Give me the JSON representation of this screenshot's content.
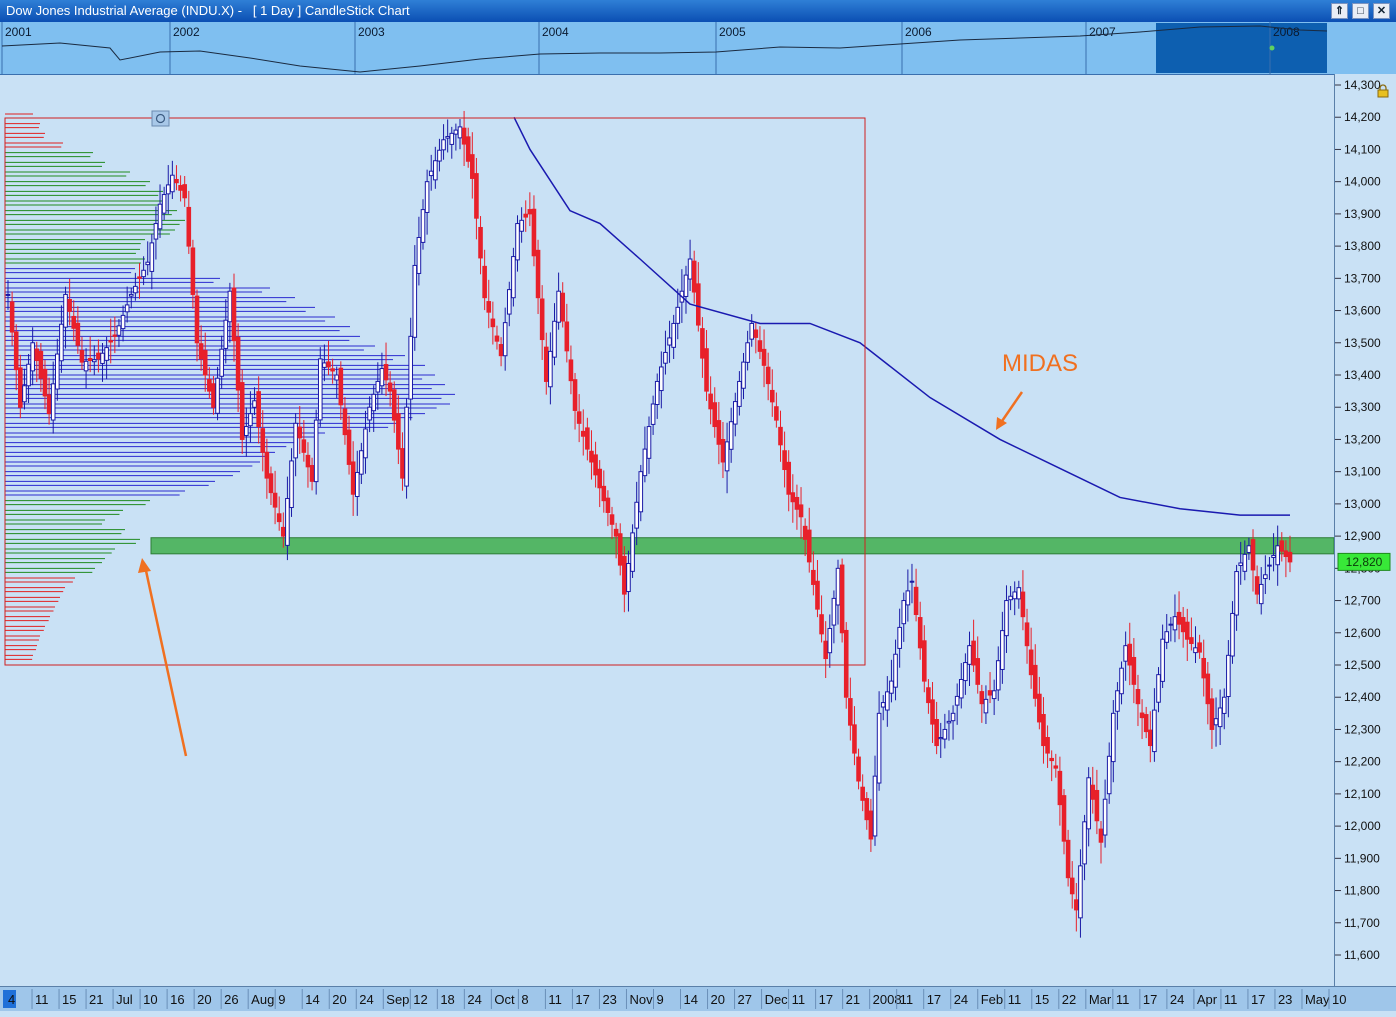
{
  "window": {
    "title": "Dow Jones Industrial Average (INDU.X) -   [ 1 Day ] CandleStick Chart",
    "buttons": [
      "⇑",
      "□",
      "✕"
    ]
  },
  "overview": {
    "years": [
      "2001",
      "2002",
      "2003",
      "2004",
      "2005",
      "2006",
      "2007",
      "2008"
    ]
  },
  "annotations": {
    "midas_label": "MIDAS"
  },
  "colors": {
    "up": "#1a1aa6",
    "down": "#e8202a",
    "midas_line": "#1a1ab0",
    "profile_blue": "#2a2ad0",
    "profile_green": "#1e8a1e",
    "profile_red": "#e02020",
    "zone_fill": "#3fae4c",
    "arrow": "#f07020",
    "box": "#d02020",
    "last_price_bg": "#38e838"
  },
  "chart_data": {
    "type": "candlestick",
    "ylim": [
      11580,
      14330
    ],
    "y_ticks": [
      14300,
      14200,
      14100,
      14000,
      13900,
      13800,
      13700,
      13600,
      13500,
      13400,
      13300,
      13200,
      13100,
      13000,
      12900,
      12800,
      12700,
      12600,
      12500,
      12400,
      12300,
      12200,
      12100,
      12000,
      11900,
      11800,
      11700,
      11600
    ],
    "y_tick_labels": [
      "14,300",
      "14,200",
      "14,100",
      "14,000",
      "13,900",
      "13,800",
      "13,700",
      "13,600",
      "13,500",
      "13,400",
      "13,300",
      "13,200",
      "13,100",
      "13,000",
      "12,900",
      "12,800",
      "12,700",
      "12,600",
      "12,500",
      "12,400",
      "12,300",
      "12,200",
      "12,100",
      "12,000",
      "11,900",
      "11,800",
      "11,700",
      "11,600"
    ],
    "last_price": 12820,
    "last_price_label": "12,820",
    "support_zone": [
      12845,
      12895
    ],
    "x_labels": [
      "4",
      "11",
      "15",
      "21",
      "Jul",
      "10",
      "16",
      "20",
      "26",
      "Aug",
      "9",
      "14",
      "20",
      "24",
      "Sep",
      "12",
      "18",
      "24",
      "Oct",
      "8",
      "11",
      "17",
      "23",
      "Nov",
      "9",
      "14",
      "20",
      "27",
      "Dec",
      "11",
      "17",
      "21",
      "2008",
      "11",
      "17",
      "24",
      "Feb",
      "11",
      "15",
      "22",
      "Mar",
      "11",
      "17",
      "24",
      "Apr",
      "11",
      "17",
      "23",
      "May",
      "10"
    ],
    "anchors": [
      [
        0,
        13650
      ],
      [
        3,
        13300
      ],
      [
        6,
        13500
      ],
      [
        10,
        13280
      ],
      [
        14,
        13650
      ],
      [
        18,
        13440
      ],
      [
        22,
        13450
      ],
      [
        26,
        13520
      ],
      [
        30,
        13650
      ],
      [
        34,
        13750
      ],
      [
        37,
        13930
      ],
      [
        40,
        14020
      ],
      [
        43,
        13950
      ],
      [
        46,
        13500
      ],
      [
        50,
        13300
      ],
      [
        54,
        13660
      ],
      [
        57,
        13200
      ],
      [
        60,
        13320
      ],
      [
        63,
        13080
      ],
      [
        67,
        12900
      ],
      [
        70,
        13250
      ],
      [
        74,
        13070
      ],
      [
        76,
        13450
      ],
      [
        80,
        13400
      ],
      [
        84,
        13030
      ],
      [
        88,
        13300
      ],
      [
        91,
        13420
      ],
      [
        93,
        13350
      ],
      [
        96,
        13080
      ],
      [
        99,
        13740
      ],
      [
        102,
        14000
      ],
      [
        106,
        14130
      ],
      [
        110,
        14170
      ],
      [
        113,
        14010
      ],
      [
        116,
        13640
      ],
      [
        120,
        13460
      ],
      [
        124,
        13870
      ],
      [
        127,
        13900
      ],
      [
        131,
        13380
      ],
      [
        134,
        13660
      ],
      [
        138,
        13290
      ],
      [
        141,
        13170
      ],
      [
        145,
        13010
      ],
      [
        148,
        12900
      ],
      [
        150,
        12720
      ],
      [
        154,
        13100
      ],
      [
        158,
        13380
      ],
      [
        162,
        13560
      ],
      [
        166,
        13760
      ],
      [
        170,
        13350
      ],
      [
        174,
        13130
      ],
      [
        178,
        13380
      ],
      [
        181,
        13560
      ],
      [
        184,
        13430
      ],
      [
        187,
        13260
      ],
      [
        190,
        13030
      ],
      [
        193,
        12960
      ],
      [
        196,
        12750
      ],
      [
        199,
        12520
      ],
      [
        202,
        12800
      ],
      [
        204,
        12400
      ],
      [
        207,
        12140
      ],
      [
        210,
        11960
      ],
      [
        212,
        12350
      ],
      [
        215,
        12450
      ],
      [
        218,
        12700
      ],
      [
        220,
        12760
      ],
      [
        223,
        12450
      ],
      [
        226,
        12250
      ],
      [
        230,
        12350
      ],
      [
        234,
        12560
      ],
      [
        237,
        12380
      ],
      [
        240,
        12420
      ],
      [
        243,
        12700
      ],
      [
        246,
        12740
      ],
      [
        249,
        12470
      ],
      [
        252,
        12250
      ],
      [
        255,
        12180
      ],
      [
        258,
        11840
      ],
      [
        260,
        11740
      ],
      [
        263,
        12150
      ],
      [
        266,
        11950
      ],
      [
        269,
        12350
      ],
      [
        272,
        12560
      ],
      [
        275,
        12380
      ],
      [
        278,
        12250
      ],
      [
        281,
        12580
      ],
      [
        284,
        12650
      ],
      [
        287,
        12580
      ],
      [
        290,
        12540
      ],
      [
        293,
        12300
      ],
      [
        296,
        12400
      ],
      [
        299,
        12790
      ],
      [
        302,
        12870
      ],
      [
        304,
        12720
      ],
      [
        307,
        12810
      ],
      [
        309,
        12870
      ],
      [
        312,
        12820
      ]
    ],
    "midas_series": [
      [
        514,
        14200
      ],
      [
        530,
        14100
      ],
      [
        570,
        13910
      ],
      [
        600,
        13870
      ],
      [
        640,
        13760
      ],
      [
        690,
        13620
      ],
      [
        760,
        13560
      ],
      [
        810,
        13560
      ],
      [
        860,
        13500
      ],
      [
        930,
        13330
      ],
      [
        1000,
        13200
      ],
      [
        1060,
        13110
      ],
      [
        1120,
        13020
      ],
      [
        1180,
        12985
      ],
      [
        1240,
        12965
      ],
      [
        1290,
        12965
      ]
    ],
    "profile": [
      [
        14210,
        28,
        "red"
      ],
      [
        14180,
        35,
        "red"
      ],
      [
        14150,
        40,
        "red"
      ],
      [
        14120,
        58,
        "red"
      ],
      [
        14090,
        88,
        "green"
      ],
      [
        14060,
        100,
        "green"
      ],
      [
        14030,
        125,
        "green"
      ],
      [
        14000,
        145,
        "green"
      ],
      [
        13970,
        158,
        "green"
      ],
      [
        13940,
        160,
        "green"
      ],
      [
        13910,
        172,
        "green"
      ],
      [
        13880,
        180,
        "green"
      ],
      [
        13850,
        170,
        "green"
      ],
      [
        13820,
        140,
        "green"
      ],
      [
        13790,
        135,
        "green"
      ],
      [
        13760,
        140,
        "green"
      ],
      [
        13730,
        130,
        "blue"
      ],
      [
        13700,
        215,
        "blue"
      ],
      [
        13670,
        265,
        "blue"
      ],
      [
        13640,
        290,
        "blue"
      ],
      [
        13610,
        310,
        "blue"
      ],
      [
        13580,
        330,
        "blue"
      ],
      [
        13550,
        345,
        "blue"
      ],
      [
        13520,
        355,
        "blue"
      ],
      [
        13490,
        370,
        "blue"
      ],
      [
        13460,
        400,
        "blue"
      ],
      [
        13430,
        420,
        "blue"
      ],
      [
        13400,
        430,
        "blue"
      ],
      [
        13370,
        440,
        "blue"
      ],
      [
        13340,
        450,
        "blue"
      ],
      [
        13310,
        445,
        "blue"
      ],
      [
        13280,
        420,
        "blue"
      ],
      [
        13250,
        395,
        "blue"
      ],
      [
        13220,
        320,
        "blue"
      ],
      [
        13190,
        290,
        "blue"
      ],
      [
        13160,
        270,
        "blue"
      ],
      [
        13130,
        255,
        "blue"
      ],
      [
        13100,
        235,
        "blue"
      ],
      [
        13070,
        210,
        "blue"
      ],
      [
        13040,
        180,
        "blue"
      ],
      [
        13010,
        145,
        "green"
      ],
      [
        12980,
        118,
        "green"
      ],
      [
        12950,
        100,
        "green"
      ],
      [
        12920,
        120,
        "green"
      ],
      [
        12890,
        135,
        "green"
      ],
      [
        12860,
        110,
        "green"
      ],
      [
        12830,
        100,
        "green"
      ],
      [
        12800,
        90,
        "green"
      ],
      [
        12770,
        70,
        "red"
      ],
      [
        12740,
        60,
        "red"
      ],
      [
        12710,
        55,
        "red"
      ],
      [
        12680,
        50,
        "red"
      ],
      [
        12650,
        45,
        "red"
      ],
      [
        12620,
        40,
        "red"
      ],
      [
        12590,
        35,
        "red"
      ],
      [
        12560,
        32,
        "red"
      ],
      [
        12530,
        28,
        "red"
      ]
    ]
  }
}
